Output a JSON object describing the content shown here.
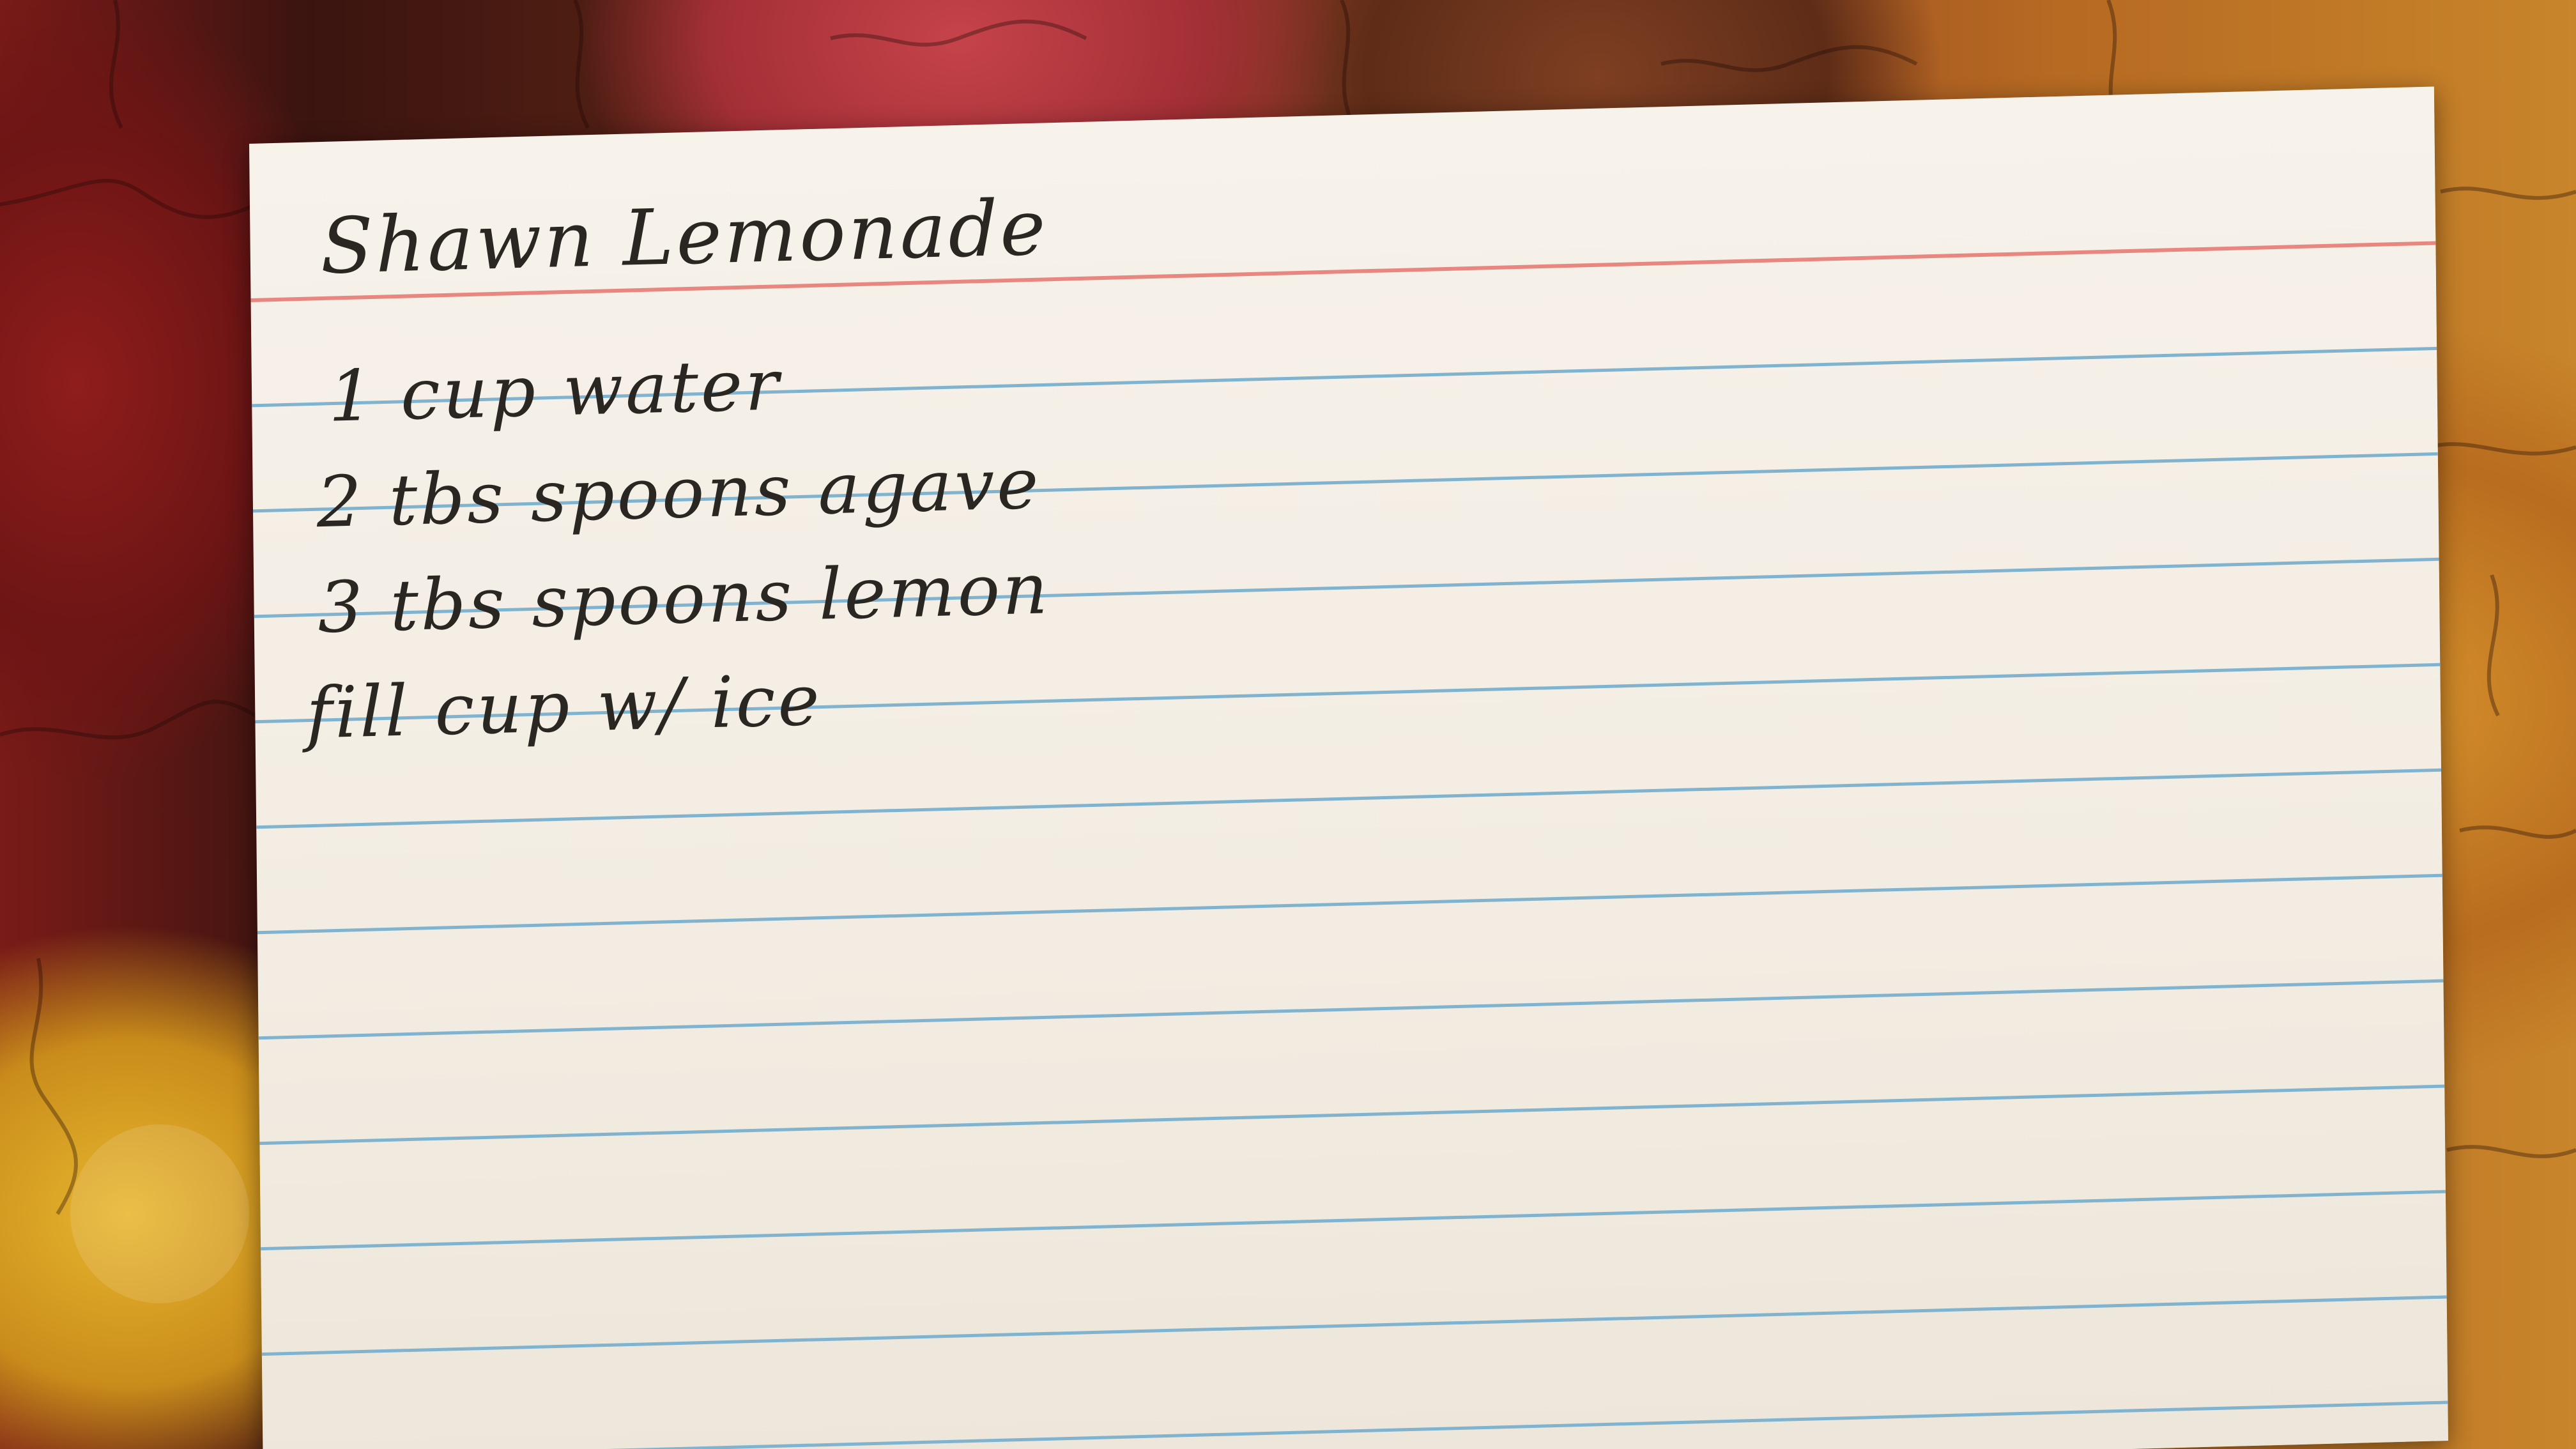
{
  "card": {
    "title": "Shawn Lemonade",
    "lines": [
      "1 cup water",
      "2 tbs spoons agave",
      "3 tbs spoons lemon",
      "fill cup w/ ice"
    ]
  },
  "colors": {
    "card": "#f4eee5",
    "header_rule": "#e8877f",
    "ruled_line": "#7fb3cf",
    "ink": "#2a2622",
    "puzzle_red": "#a32f36",
    "puzzle_orange": "#c8852a",
    "puzzle_yellow": "#e7b62e"
  }
}
